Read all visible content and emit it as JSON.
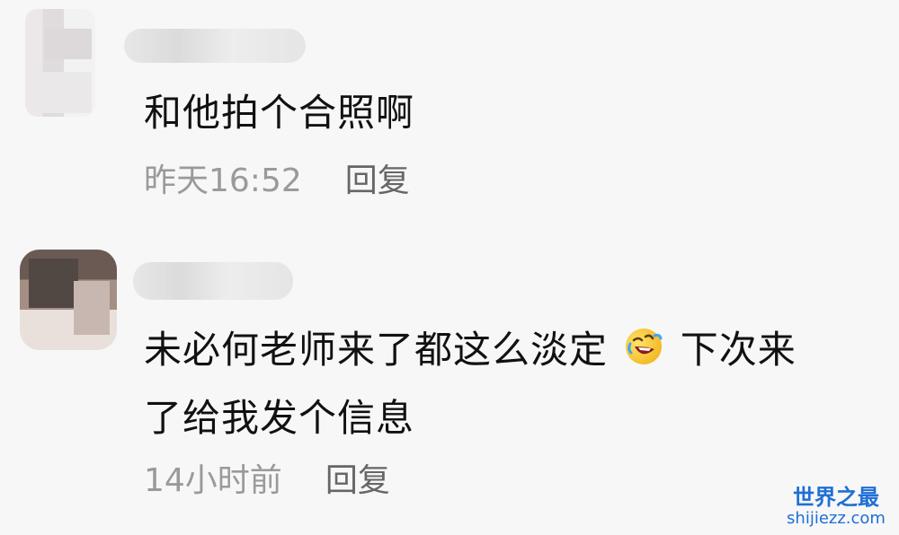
{
  "comments": [
    {
      "text": "和他拍个合照啊",
      "timestamp": "昨天16:52",
      "reply_label": "回复"
    },
    {
      "text_before_emoji": "未必何老师来了都这么淡定",
      "emoji": "rolling-on-floor-laughing-icon",
      "text_after_emoji": "下次来",
      "text_line_2": "了给我发个信息",
      "timestamp": "14小时前",
      "reply_label": "回复"
    }
  ],
  "watermark": {
    "title": "世界之最",
    "url": "shijiezz.com"
  },
  "colors": {
    "background": "#f7f7f7",
    "text": "#111111",
    "meta": "#8e8e8e",
    "watermark": "#1f6fd6"
  }
}
